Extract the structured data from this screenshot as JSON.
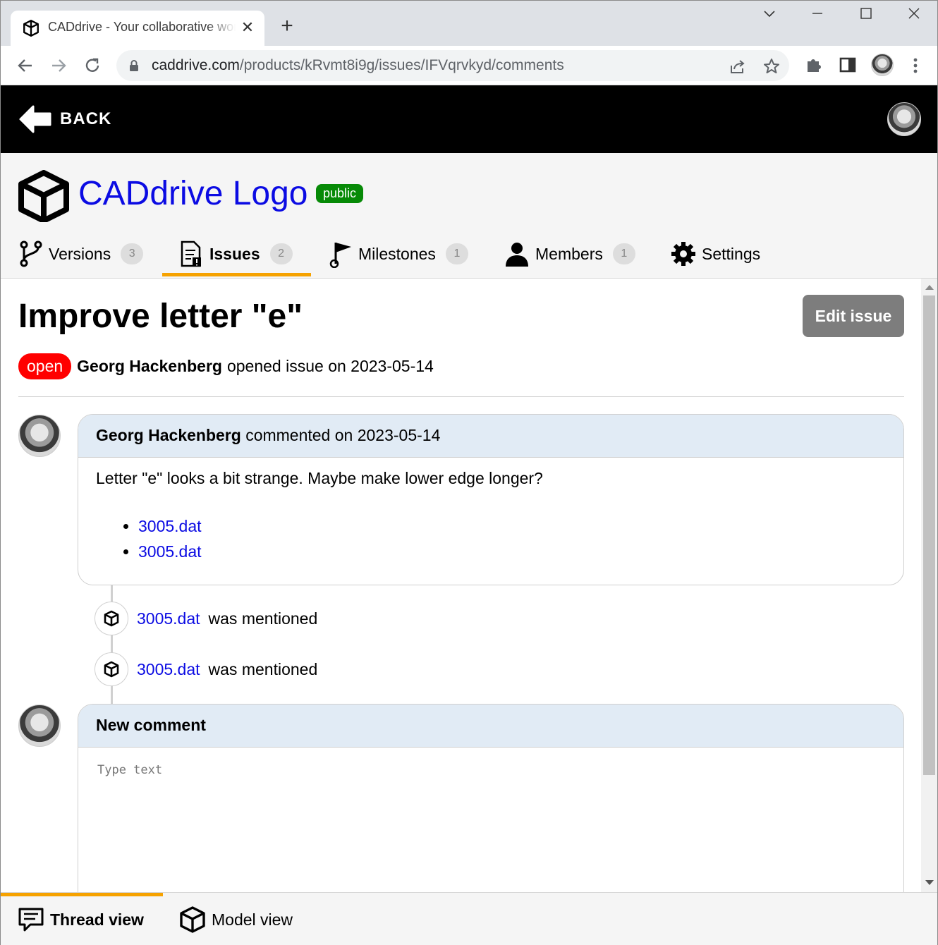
{
  "browser": {
    "tab_title": "CADdrive - Your collaborative workspace",
    "url_host": "caddrive.com",
    "url_path": "/products/kRvmt8i9g/issues/IFVqrvkyd/comments"
  },
  "header": {
    "back_label": "BACK"
  },
  "product": {
    "name": "CADdrive Logo",
    "visibility": "public"
  },
  "nav": {
    "tabs": [
      {
        "label": "Versions",
        "count": "3",
        "icon": "version-branch-icon"
      },
      {
        "label": "Issues",
        "count": "2",
        "icon": "issue-document-icon"
      },
      {
        "label": "Milestones",
        "count": "1",
        "icon": "milestone-flag-icon"
      },
      {
        "label": "Members",
        "count": "1",
        "icon": "member-person-icon"
      },
      {
        "label": "Settings",
        "icon": "gear-icon"
      }
    ],
    "active": "Issues"
  },
  "issue": {
    "title": "Improve letter \"e\"",
    "edit_label": "Edit issue",
    "state": "open",
    "author": "Georg Hackenberg",
    "opened_text": "opened issue on 2023-05-14"
  },
  "comment": {
    "author": "Georg Hackenberg",
    "meta": "commented on 2023-05-14",
    "text": "Letter \"e\" looks a bit strange. Maybe make lower edge longer?",
    "links": [
      "3005.dat",
      "3005.dat"
    ]
  },
  "mentions": [
    {
      "file": "3005.dat",
      "text": "was mentioned"
    },
    {
      "file": "3005.dat",
      "text": "was mentioned"
    }
  ],
  "new_comment": {
    "title": "New comment",
    "placeholder": "Type text"
  },
  "bottom_tabs": {
    "thread": "Thread view",
    "model": "Model view",
    "active": "Thread view"
  },
  "colors": {
    "link": "#0b0be3",
    "accent": "#f6a200",
    "public_badge": "#078a07",
    "open_badge": "#ff0000",
    "comment_header": "#e1ebf5"
  }
}
